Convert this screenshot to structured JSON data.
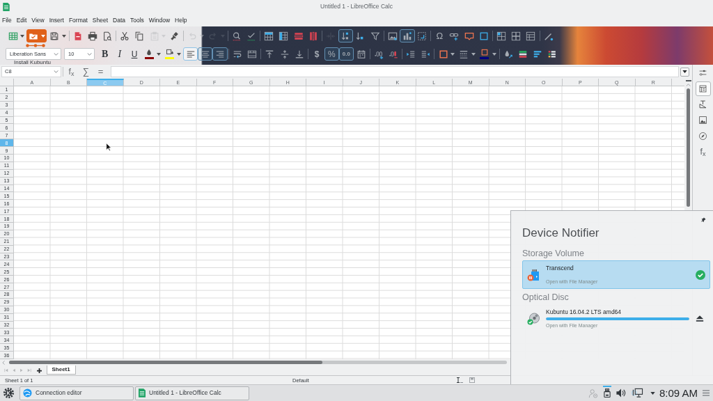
{
  "window": {
    "title": "Untitled 1 - LibreOffice Calc"
  },
  "menu": [
    "File",
    "Edit",
    "View",
    "Insert",
    "Format",
    "Sheet",
    "Data",
    "Tools",
    "Window",
    "Help"
  ],
  "toolbar": {
    "rows": [
      {
        "groups": [
          [
            {
              "kind": "table",
              "dropdown": true,
              "selected": false,
              "disabled": false,
              "hovered": false
            },
            {
              "kind": "open",
              "dropdown": true,
              "selected": false,
              "disabled": false,
              "hovered": true
            },
            {
              "kind": "save",
              "dropdown": true,
              "selected": false,
              "disabled": false,
              "hovered": false
            }
          ],
          [
            {
              "kind": "pdf",
              "selected": false,
              "disabled": false,
              "hovered": false
            },
            {
              "kind": "print",
              "selected": false,
              "disabled": false,
              "hovered": false
            },
            {
              "kind": "preview",
              "selected": false,
              "disabled": false,
              "hovered": false
            }
          ],
          [
            {
              "kind": "cut",
              "selected": false,
              "disabled": false,
              "hovered": false
            },
            {
              "kind": "copy",
              "selected": false,
              "disabled": false,
              "hovered": false
            },
            {
              "kind": "paste",
              "dropdown": true,
              "selected": false,
              "disabled": true,
              "hovered": false
            },
            {
              "kind": "brush",
              "selected": false,
              "disabled": false,
              "hovered": false
            }
          ],
          [
            {
              "kind": "undo",
              "dropdown": true,
              "selected": false,
              "disabled": true,
              "hovered": false
            },
            {
              "kind": "redo",
              "dropdown": true,
              "selected": false,
              "disabled": true,
              "hovered": false
            }
          ],
          [
            {
              "kind": "find",
              "selected": false,
              "disabled": false,
              "hovered": false
            },
            {
              "kind": "spelling",
              "selected": false,
              "disabled": false,
              "hovered": false
            }
          ],
          [
            {
              "kind": "insert_rows",
              "selected": false,
              "disabled": false,
              "hovered": false
            },
            {
              "kind": "insert_columns",
              "selected": false,
              "disabled": false,
              "hovered": false
            },
            {
              "kind": "delete_rows",
              "selected": false,
              "disabled": false,
              "hovered": false
            },
            {
              "kind": "delete_columns",
              "selected": false,
              "disabled": false,
              "hovered": false
            }
          ],
          [
            {
              "kind": "merge",
              "selected": false,
              "disabled": true,
              "hovered": false
            },
            {
              "kind": "sort",
              "selected": true,
              "disabled": false,
              "hovered": false
            },
            {
              "kind": "sort_descending",
              "selected": false,
              "disabled": false,
              "hovered": false
            },
            {
              "kind": "filter",
              "selected": false,
              "disabled": false,
              "hovered": false
            }
          ],
          [
            {
              "kind": "image",
              "selected": false,
              "disabled": false,
              "hovered": false
            },
            {
              "kind": "chart",
              "selected": true,
              "disabled": false,
              "hovered": false
            },
            {
              "kind": "pivot",
              "selected": false,
              "disabled": false,
              "hovered": false
            }
          ],
          [
            {
              "kind": "special_character",
              "label": "Ω",
              "selected": false,
              "disabled": false,
              "hovered": false
            },
            {
              "kind": "hyperlink",
              "selected": false,
              "disabled": false,
              "hovered": false
            },
            {
              "kind": "comment",
              "selected": false,
              "disabled": false,
              "hovered": false
            },
            {
              "kind": "headers",
              "selected": false,
              "disabled": false,
              "hovered": false
            }
          ],
          [
            {
              "kind": "freeze",
              "selected": false,
              "disabled": false,
              "hovered": false
            },
            {
              "kind": "split",
              "selected": false,
              "disabled": false,
              "hovered": false
            },
            {
              "kind": "print_area",
              "selected": false,
              "disabled": false,
              "hovered": false
            }
          ],
          [
            {
              "kind": "draw",
              "selected": false,
              "disabled": false,
              "hovered": false
            }
          ]
        ]
      },
      {
        "groups": [
          [
            {
              "kind": "font_name",
              "value": "Liberation Sans",
              "selected": false,
              "disabled": false,
              "hovered": false
            },
            {
              "kind": "font_size",
              "value": "10",
              "selected": false,
              "disabled": false,
              "hovered": false
            },
            {
              "kind": "bold",
              "label": "B",
              "selected": false,
              "disabled": false,
              "hovered": false
            },
            {
              "kind": "italic",
              "label": "I",
              "selected": false,
              "disabled": false,
              "hovered": false
            },
            {
              "kind": "underline",
              "label": "U",
              "selected": false,
              "disabled": false,
              "hovered": false
            },
            {
              "kind": "font_color",
              "color": "#8b0000",
              "dropdown": true,
              "selected": false,
              "disabled": false,
              "hovered": false
            },
            {
              "kind": "highlight",
              "color": "#ffff00",
              "dropdown": true,
              "selected": false,
              "disabled": false,
              "hovered": false
            },
            {
              "kind": "align_left",
              "selected": true,
              "disabled": false,
              "hovered": false
            },
            {
              "kind": "align_center",
              "selected": true,
              "disabled": false,
              "hovered": false
            },
            {
              "kind": "align_right",
              "selected": true,
              "disabled": false,
              "hovered": false
            }
          ],
          [
            {
              "kind": "wrap",
              "selected": false,
              "disabled": false,
              "hovered": false
            },
            {
              "kind": "merge_center",
              "selected": false,
              "disabled": false,
              "hovered": false
            }
          ],
          [
            {
              "kind": "align_top",
              "selected": false,
              "disabled": false,
              "hovered": false
            },
            {
              "kind": "align_middle",
              "selected": false,
              "disabled": false,
              "hovered": false
            },
            {
              "kind": "align_bottom",
              "selected": false,
              "disabled": false,
              "hovered": false
            }
          ],
          [
            {
              "kind": "currency",
              "label": "$",
              "selected": false,
              "disabled": false,
              "hovered": false
            },
            {
              "kind": "percent",
              "label": "%",
              "selected": true,
              "disabled": false,
              "hovered": false
            },
            {
              "kind": "number",
              "label": "0.0",
              "selected": true,
              "disabled": false,
              "hovered": false
            },
            {
              "kind": "date",
              "selected": false,
              "disabled": false,
              "hovered": false
            }
          ],
          [
            {
              "kind": "add_decimal",
              "selected": false,
              "disabled": false,
              "hovered": false
            },
            {
              "kind": "delete_decimal",
              "selected": false,
              "disabled": false,
              "hovered": false
            }
          ],
          [
            {
              "kind": "indent",
              "selected": false,
              "disabled": false,
              "hovered": false
            },
            {
              "kind": "outdent",
              "selected": false,
              "disabled": false,
              "hovered": false
            }
          ],
          [
            {
              "kind": "borders",
              "dropdown": true,
              "selected": false,
              "disabled": false,
              "hovered": false
            },
            {
              "kind": "border_style",
              "dropdown": true,
              "selected": false,
              "disabled": false,
              "hovered": false
            },
            {
              "kind": "border_color",
              "color": "#000080",
              "dropdown": true,
              "selected": false,
              "disabled": false,
              "hovered": false
            }
          ],
          [
            {
              "kind": "conditional",
              "selected": false,
              "disabled": false,
              "hovered": false
            },
            {
              "kind": "color_scale",
              "selected": false,
              "disabled": false,
              "hovered": false
            },
            {
              "kind": "data_bar",
              "selected": false,
              "disabled": false,
              "hovered": false
            },
            {
              "kind": "icon_set",
              "selected": false,
              "disabled": false,
              "hovered": false
            }
          ]
        ]
      }
    ],
    "overlay_label": "Install Kubuntu"
  },
  "formula_bar": {
    "name_box": "C8",
    "function_wizard": "f$_{x}$",
    "sum": "∑",
    "equals": "="
  },
  "sheet": {
    "columns": [
      {
        "label": "A",
        "selected": false
      },
      {
        "label": "B",
        "selected": false
      },
      {
        "label": "C",
        "selected": true
      },
      {
        "label": "D",
        "selected": false
      },
      {
        "label": "E",
        "selected": false
      },
      {
        "label": "F",
        "selected": false
      },
      {
        "label": "G",
        "selected": false
      },
      {
        "label": "H",
        "selected": false
      },
      {
        "label": "I",
        "selected": false
      },
      {
        "label": "J",
        "selected": false
      },
      {
        "label": "K",
        "selected": false
      },
      {
        "label": "L",
        "selected": false
      },
      {
        "label": "M",
        "selected": false
      },
      {
        "label": "N",
        "selected": false
      },
      {
        "label": "O",
        "selected": false
      },
      {
        "label": "P",
        "selected": false
      },
      {
        "label": "Q",
        "selected": false
      },
      {
        "label": "R",
        "selected": false
      }
    ],
    "rows": [
      {
        "label": "1",
        "selected": false
      },
      {
        "label": "2",
        "selected": false
      },
      {
        "label": "3",
        "selected": false
      },
      {
        "label": "4",
        "selected": false
      },
      {
        "label": "5",
        "selected": false
      },
      {
        "label": "6",
        "selected": false
      },
      {
        "label": "7",
        "selected": false
      },
      {
        "label": "8",
        "selected": true
      },
      {
        "label": "9",
        "selected": false
      },
      {
        "label": "10",
        "selected": false
      },
      {
        "label": "11",
        "selected": false
      },
      {
        "label": "12",
        "selected": false
      },
      {
        "label": "13",
        "selected": false
      },
      {
        "label": "14",
        "selected": false
      },
      {
        "label": "15",
        "selected": false
      },
      {
        "label": "16",
        "selected": false
      },
      {
        "label": "17",
        "selected": false
      },
      {
        "label": "18",
        "selected": false
      },
      {
        "label": "19",
        "selected": false
      },
      {
        "label": "20",
        "selected": false
      },
      {
        "label": "21",
        "selected": false
      },
      {
        "label": "22",
        "selected": false
      },
      {
        "label": "23",
        "selected": false
      },
      {
        "label": "24",
        "selected": false
      },
      {
        "label": "25",
        "selected": false
      },
      {
        "label": "26",
        "selected": false
      },
      {
        "label": "27",
        "selected": false
      },
      {
        "label": "28",
        "selected": false
      },
      {
        "label": "29",
        "selected": false
      },
      {
        "label": "30",
        "selected": false
      },
      {
        "label": "31",
        "selected": false
      },
      {
        "label": "32",
        "selected": false
      },
      {
        "label": "33",
        "selected": false
      },
      {
        "label": "34",
        "selected": false
      },
      {
        "label": "35",
        "selected": false
      },
      {
        "label": "36",
        "selected": false
      }
    ]
  },
  "sheet_navigation": [
    {
      "kind": "first",
      "disabled": true
    },
    {
      "kind": "previous",
      "disabled": true
    },
    {
      "kind": "next",
      "disabled": true
    },
    {
      "kind": "last",
      "disabled": true
    }
  ],
  "sheet_tabs": [
    {
      "label": "Sheet1",
      "selected": true
    }
  ],
  "status_bar": {
    "sheet_info": "Sheet 1 of 1",
    "page_style": "Default"
  },
  "sidebar": {
    "items": [
      {
        "kind": "menu",
        "selected": false
      },
      {
        "kind": "properties",
        "selected": true
      },
      {
        "kind": "styles",
        "selected": false
      },
      {
        "kind": "gallery",
        "selected": false
      },
      {
        "kind": "navigator",
        "selected": false
      },
      {
        "kind": "functions",
        "label": "f$_{x}$",
        "selected": false
      }
    ]
  },
  "taskbar": {
    "tasks": [
      {
        "kind": "browser",
        "label": "Connection editor",
        "selected": false
      },
      {
        "kind": "calc",
        "label": "Untitled 1 - LibreOffice Calc",
        "selected": false
      }
    ],
    "tray": [
      {
        "kind": "user",
        "dimmed": true,
        "active": false
      },
      {
        "kind": "device",
        "dimmed": false,
        "active": true
      },
      {
        "kind": "volume",
        "dimmed": false,
        "active": false
      },
      {
        "kind": "network",
        "dimmed": false,
        "active": false
      }
    ],
    "clock": "8:09 AM"
  },
  "device_notifier": {
    "title": "Device Notifier",
    "sections": [
      {
        "title": "Storage Volume",
        "devices": [
          {
            "kind": "card",
            "name": "Transcend",
            "action": "Open with File Manager",
            "selected": true
          }
        ]
      },
      {
        "title": "Optical Disc",
        "devices": [
          {
            "kind": "disc",
            "name": "Kubuntu 16.04.2 LTS amd64",
            "level": 1,
            "action": "Open with File Manager",
            "selected": false
          }
        ]
      }
    ]
  }
}
